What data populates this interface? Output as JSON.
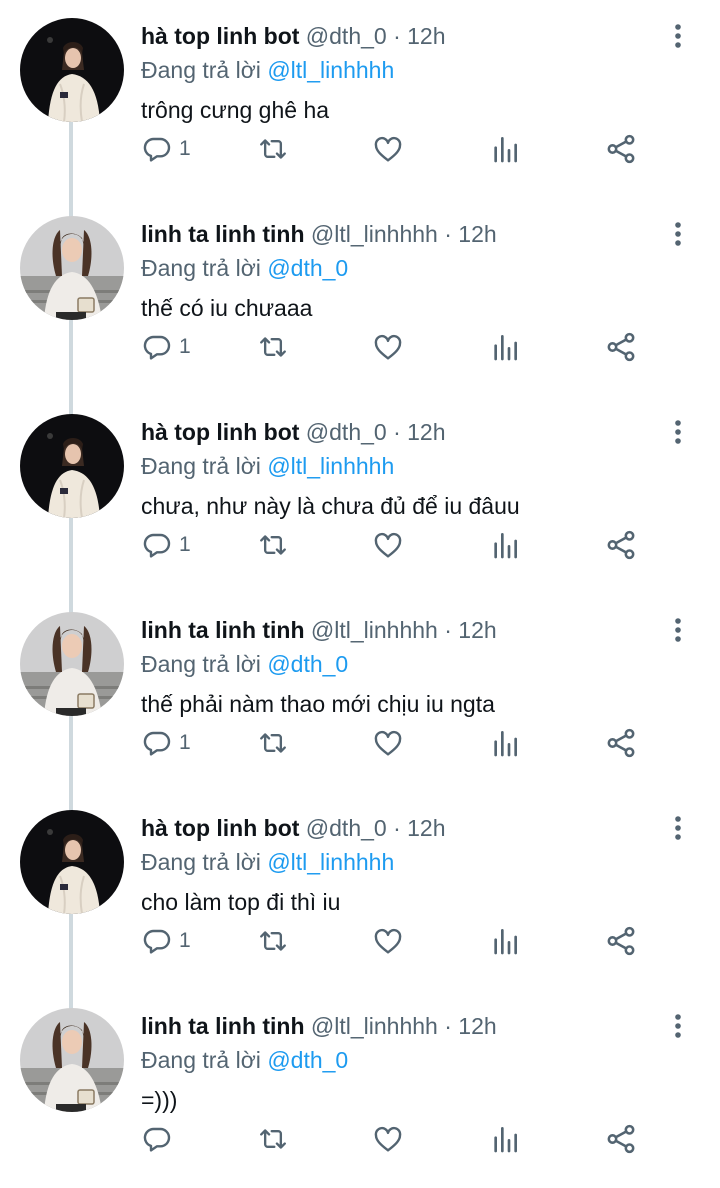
{
  "tweets": [
    {
      "name": "hà top linh bot",
      "handle": "@dth_0",
      "time": "· 12h",
      "replying_prefix": "Đang trả lời",
      "replying_to": "@ltl_linhhhh",
      "text": "trông cưng ghê ha",
      "reply_count": "1",
      "avatar": "dark"
    },
    {
      "name": "linh ta linh tinh",
      "handle": "@ltl_linhhhh",
      "time": "· 12h",
      "replying_prefix": "Đang trả lời",
      "replying_to": "@dth_0",
      "text": "thế có iu chưaaa",
      "reply_count": "1",
      "avatar": "light"
    },
    {
      "name": "hà top linh bot",
      "handle": "@dth_0",
      "time": "· 12h",
      "replying_prefix": "Đang trả lời",
      "replying_to": "@ltl_linhhhh",
      "text": "chưa, như này là chưa đủ để iu đâuu",
      "reply_count": "1",
      "avatar": "dark"
    },
    {
      "name": "linh ta linh tinh",
      "handle": "@ltl_linhhhh",
      "time": "· 12h",
      "replying_prefix": "Đang trả lời",
      "replying_to": "@dth_0",
      "text": "thế phải nàm thao mới chịu iu ngta",
      "reply_count": "1",
      "avatar": "light"
    },
    {
      "name": "hà top linh bot",
      "handle": "@dth_0",
      "time": "· 12h",
      "replying_prefix": "Đang trả lời",
      "replying_to": "@ltl_linhhhh",
      "text": "cho làm top đi thì iu",
      "reply_count": "1",
      "avatar": "dark"
    },
    {
      "name": "linh ta linh tinh",
      "handle": "@ltl_linhhhh",
      "time": "· 12h",
      "replying_prefix": "Đang trả lời",
      "replying_to": "@dth_0",
      "text": "=)))",
      "reply_count": "",
      "avatar": "light"
    }
  ],
  "icons": [
    "reply-icon",
    "retweet-icon",
    "like-icon",
    "analytics-icon",
    "share-icon",
    "more-icon"
  ],
  "colors": {
    "mention": "#1d9bf0",
    "meta": "#536471",
    "thread_line": "#cfd9de",
    "name": "#0f1419"
  }
}
